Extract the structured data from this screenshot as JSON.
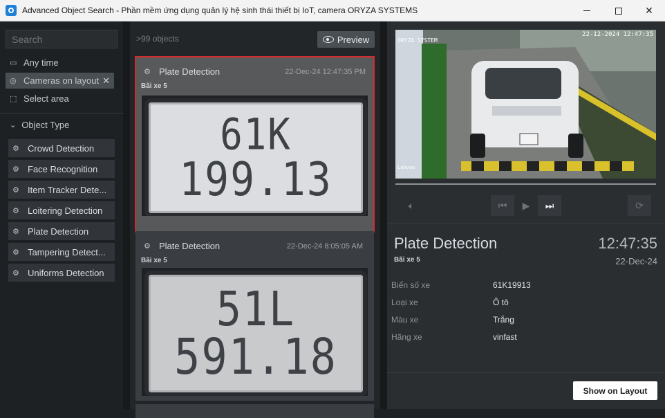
{
  "window": {
    "title": "Advanced Object Search - Phần mềm ứng dụng quản lý hệ sinh thái thiết bị IoT, camera ORYZA SYSTEMS"
  },
  "left_panel": {
    "search_placeholder": "Search",
    "filters": {
      "time": "Any time",
      "cameras": "Cameras on layout",
      "area": "Select area"
    },
    "object_type_header": "Object Type",
    "object_types": [
      "Crowd Detection",
      "Face Recognition",
      "Item Tracker Dete...",
      "Loitering Detection",
      "Plate Detection",
      "Tampering Detect...",
      "Uniforms Detection"
    ]
  },
  "results": {
    "count": ">99 objects",
    "preview_label": "Preview",
    "cards": [
      {
        "type": "Plate Detection",
        "time": "22-Dec-24 12:47:35 PM",
        "location": "Bãi xe 5",
        "plate_line1": "61K",
        "plate_line2": "199.13",
        "selected": true
      },
      {
        "type": "Plate Detection",
        "time": "22-Dec-24 8:05:05 AM",
        "location": "Bãi xe 5",
        "plate_line1": "51L",
        "plate_line2": "591.18",
        "selected": false
      }
    ]
  },
  "preview": {
    "osd_timestamp": "22-12-2024 12:47:35",
    "osd_name": "ORYZA SYSTEM",
    "osd_camera": "Lohvae",
    "progress": 1.0,
    "detail": {
      "title": "Plate Detection",
      "time": "12:47:35",
      "location": "Bãi xe 5",
      "date": "22-Dec-24",
      "attributes": [
        {
          "key": "Biển số xe",
          "value": "61K19913"
        },
        {
          "key": "Loại xe",
          "value": "Ô tô"
        },
        {
          "key": "Màu xe",
          "value": "Trắng"
        },
        {
          "key": "Hãng xe",
          "value": "vinfast"
        }
      ]
    },
    "show_on_layout_label": "Show on Layout"
  },
  "colors": {
    "selection_outline": "#d42b2b",
    "panel_bg": "#232629",
    "accent_button": "#ffffff"
  }
}
